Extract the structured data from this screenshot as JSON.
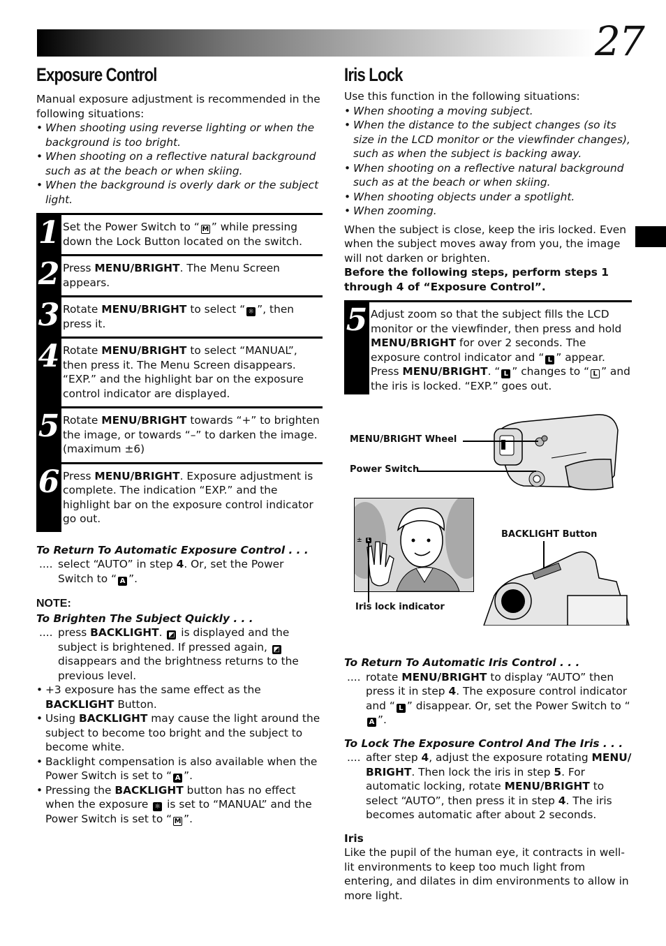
{
  "page": {
    "number": "27"
  },
  "left": {
    "title": "Exposure Control",
    "intro": "Manual exposure adjustment is recommended in the following situations:",
    "bullets": [
      "When shooting using reverse lighting or when the background is too bright.",
      "When shooting on a reflective natural background such as at the beach or when skiing.",
      "When the background is overly dark or the subject light."
    ],
    "steps": [
      {
        "num": "1",
        "parts": [
          "Set the Power Switch to “",
          "”  while pressing down the Lock Button located on the switch."
        ],
        "icon": "M"
      },
      {
        "num": "2",
        "pre": "Press ",
        "bold": "MENU/BRIGHT",
        "post": ". The Menu Screen appears."
      },
      {
        "num": "3",
        "pre": "Rotate ",
        "bold": "MENU/BRIGHT",
        "mid": " to select “",
        "icon": "exposure",
        "post": "”, then press it."
      },
      {
        "num": "4",
        "pre": "Rotate ",
        "bold": "MENU/BRIGHT",
        "post": " to select “MANUAL”, then press it. The Menu Screen disappears. “EXP.” and the highlight bar on the exposure control indicator are displayed."
      },
      {
        "num": "5",
        "pre": "Rotate ",
        "bold": "MENU/BRIGHT",
        "post": " towards “+” to brighten the image, or towards “–” to darken the image. (maximum ±6)"
      },
      {
        "num": "6",
        "pre": "Press ",
        "bold": "MENU/BRIGHT",
        "post": ". Exposure adjustment is complete. The indication “EXP.” and the highlight bar on the exposure control indicator go out."
      }
    ],
    "return_auto": {
      "heading": "To Return To Automatic Exposure Control . . .",
      "dots": "....",
      "pre": "select “AUTO” in step ",
      "bold": "4",
      "post": ". Or, set the Power Switch to “",
      "icon": "A",
      "end": "”."
    },
    "note": {
      "label": "NOTE:",
      "heading": "To Brighten The Subject Quickly . . .",
      "dots": "....",
      "quick": {
        "pre": "press ",
        "bold": "BACKLIGHT",
        "a": ".",
        "b": " is displayed and the subject is brightened. If pressed again, ",
        "c": " disappears and the brightness returns to the previous level."
      },
      "bullets": [
        {
          "pre": "+3 exposure has the same effect as the ",
          "bold": "BACKLIGHT",
          "post": " Button."
        },
        {
          "pre": "Using ",
          "bold": "BACKLIGHT",
          "post": " may cause the light around the subject to become too bright and the subject to become white."
        },
        {
          "pre": "Backlight compensation is also available when the Power Switch is set to “",
          "icon": "A",
          "post": "”."
        },
        {
          "pre": "Pressing the ",
          "bold": "BACKLIGHT",
          "mid": " button has no effect when the exposure ",
          "mid2": " is set to “MANUAL” and the Power Switch is set to “",
          "icon": "M",
          "post": "”."
        }
      ]
    }
  },
  "right": {
    "title": "Iris Lock",
    "intro": "Use this function in the following situations:",
    "bullets": [
      "When shooting a moving subject.",
      "When the distance to the subject changes (so its size in the LCD monitor or the viewfinder changes), such as when the subject is backing away.",
      "When shooting on a reflective natural background such as at the beach or when skiing.",
      "When shooting objects under a spotlight.",
      "When zooming."
    ],
    "para": "When the subject is close, keep the iris locked. Even when the subject moves away from you, the image will not darken or brighten.",
    "bold_para": "Before the following steps, perform steps 1 through 4 of “Exposure Control”.",
    "step5": {
      "num": "5",
      "a": "Adjust zoom so that the subject fills the LCD monitor or the viewfinder, then press and hold ",
      "b": "MENU/BRIGHT",
      "c": " for over 2 seconds. The exposure control indicator and “",
      "d": "” appear. Press ",
      "e": "MENU/BRIGHT",
      "f": ". “",
      "g": "” changes to “",
      "h": "” and the iris is locked. “EXP.” goes out.",
      "icon": "L"
    },
    "figure": {
      "labels": {
        "wheel": "MENU/BRIGHT Wheel",
        "power": "Power Switch",
        "backlight": "BACKLIGHT Button",
        "iris": "Iris lock indicator"
      },
      "lcd_indicator": "±"
    },
    "return_iris": {
      "heading": "To Return To Automatic Iris Control . . .",
      "dots": "....",
      "a": "rotate ",
      "b": "MENU/BRIGHT",
      "c": " to display “AUTO” then press it in step ",
      "d": "4",
      "e": ". The exposure control indicator and “",
      "f": "” disappear. Or, set the Power Switch to “",
      "g": "”."
    },
    "lock_both": {
      "heading": "To Lock The Exposure Control And The Iris . . .",
      "dots": "....",
      "a": "after step ",
      "b": "4",
      "c": ", adjust the exposure rotating ",
      "d": "MENU/ BRIGHT",
      "e": ". Then lock the iris in step ",
      "f": "5",
      "g": ". For automatic locking, rotate ",
      "h": "MENU/BRIGHT",
      "i": " to select “AUTO”, then press it in step ",
      "j": "4",
      "k": ". The iris becomes automatic after about 2 seconds."
    },
    "iris_def": {
      "term": "Iris",
      "text": "Like the pupil of the human eye, it contracts in well-lit environments to keep too much light from entering, and dilates in dim environments to allow in more light."
    }
  }
}
